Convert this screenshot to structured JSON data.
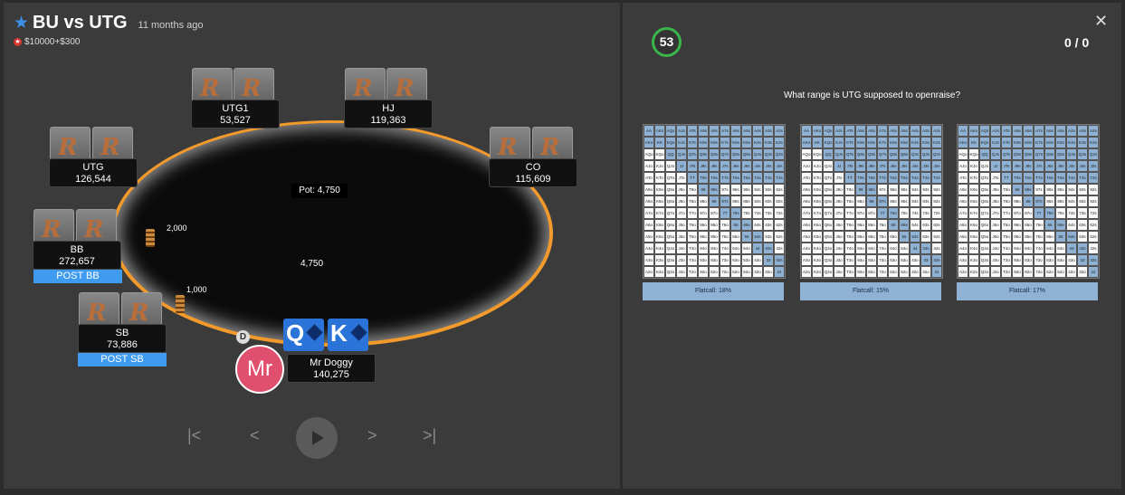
{
  "header": {
    "title": "BU vs UTG",
    "time_ago": "11 months ago",
    "stake": "$10000+$300"
  },
  "table": {
    "pot_label": "Pot: 4,750",
    "center_pot": "4,750",
    "bets": {
      "bb": "2,000",
      "sb": "1,000"
    },
    "dealer": "D",
    "seats": {
      "utg1": {
        "name": "UTG1",
        "stack": "53,527"
      },
      "hj": {
        "name": "HJ",
        "stack": "119,363"
      },
      "utg": {
        "name": "UTG",
        "stack": "126,544"
      },
      "co": {
        "name": "CO",
        "stack": "115,609"
      },
      "bb": {
        "name": "BB",
        "stack": "272,657",
        "action": "POST BB"
      },
      "sb": {
        "name": "SB",
        "stack": "73,886",
        "action": "POST SB"
      }
    },
    "hero": {
      "initials": "Mr",
      "name": "Mr Doggy",
      "stack": "140,275",
      "card1": "Q",
      "card2": "K"
    }
  },
  "quiz": {
    "timer": "53",
    "score": "0 / 0",
    "question": "What range is UTG supposed to openraise?",
    "options": [
      {
        "label": "Flatcall: 18%"
      },
      {
        "label": "Flatcall: 15%"
      },
      {
        "label": "Flatcall: 17%"
      }
    ],
    "ranks": [
      "A",
      "K",
      "Q",
      "J",
      "T",
      "9",
      "8",
      "7",
      "6",
      "5",
      "4",
      "3",
      "2"
    ]
  }
}
